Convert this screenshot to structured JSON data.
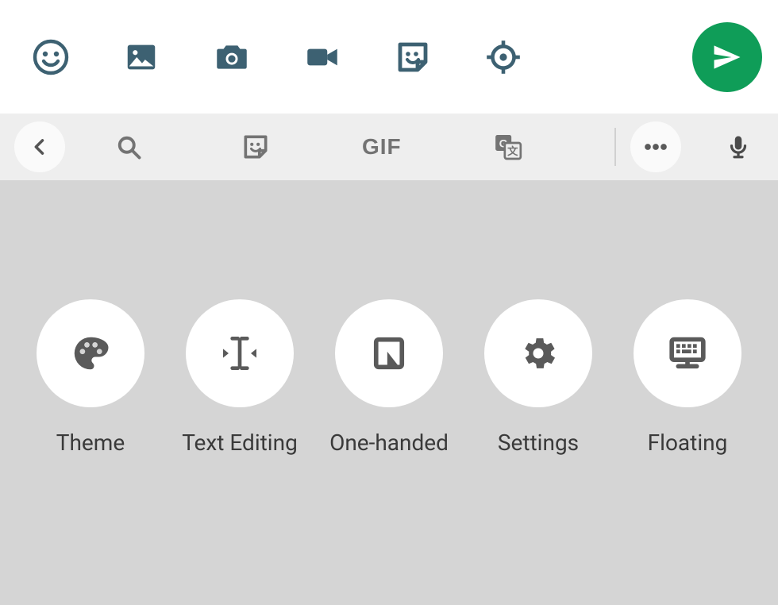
{
  "attach_bar": {
    "icons": [
      "emoji",
      "gallery",
      "camera",
      "video",
      "sticker",
      "location"
    ],
    "send": "send"
  },
  "suggestion_strip": {
    "back": "back",
    "items": [
      "search",
      "sticker",
      "gif",
      "translate"
    ],
    "gif_label": "GIF",
    "more": "more",
    "mic": "mic"
  },
  "options": [
    {
      "id": "theme",
      "label": "Theme"
    },
    {
      "id": "text-editing",
      "label": "Text Editing"
    },
    {
      "id": "one-handed",
      "label": "One-handed"
    },
    {
      "id": "settings",
      "label": "Settings"
    },
    {
      "id": "floating",
      "label": "Floating"
    }
  ],
  "colors": {
    "send_bg": "#0f9d58",
    "attach_icon": "#3d6172",
    "strip_icon": "#737373",
    "option_icon": "#5a5a5a"
  }
}
